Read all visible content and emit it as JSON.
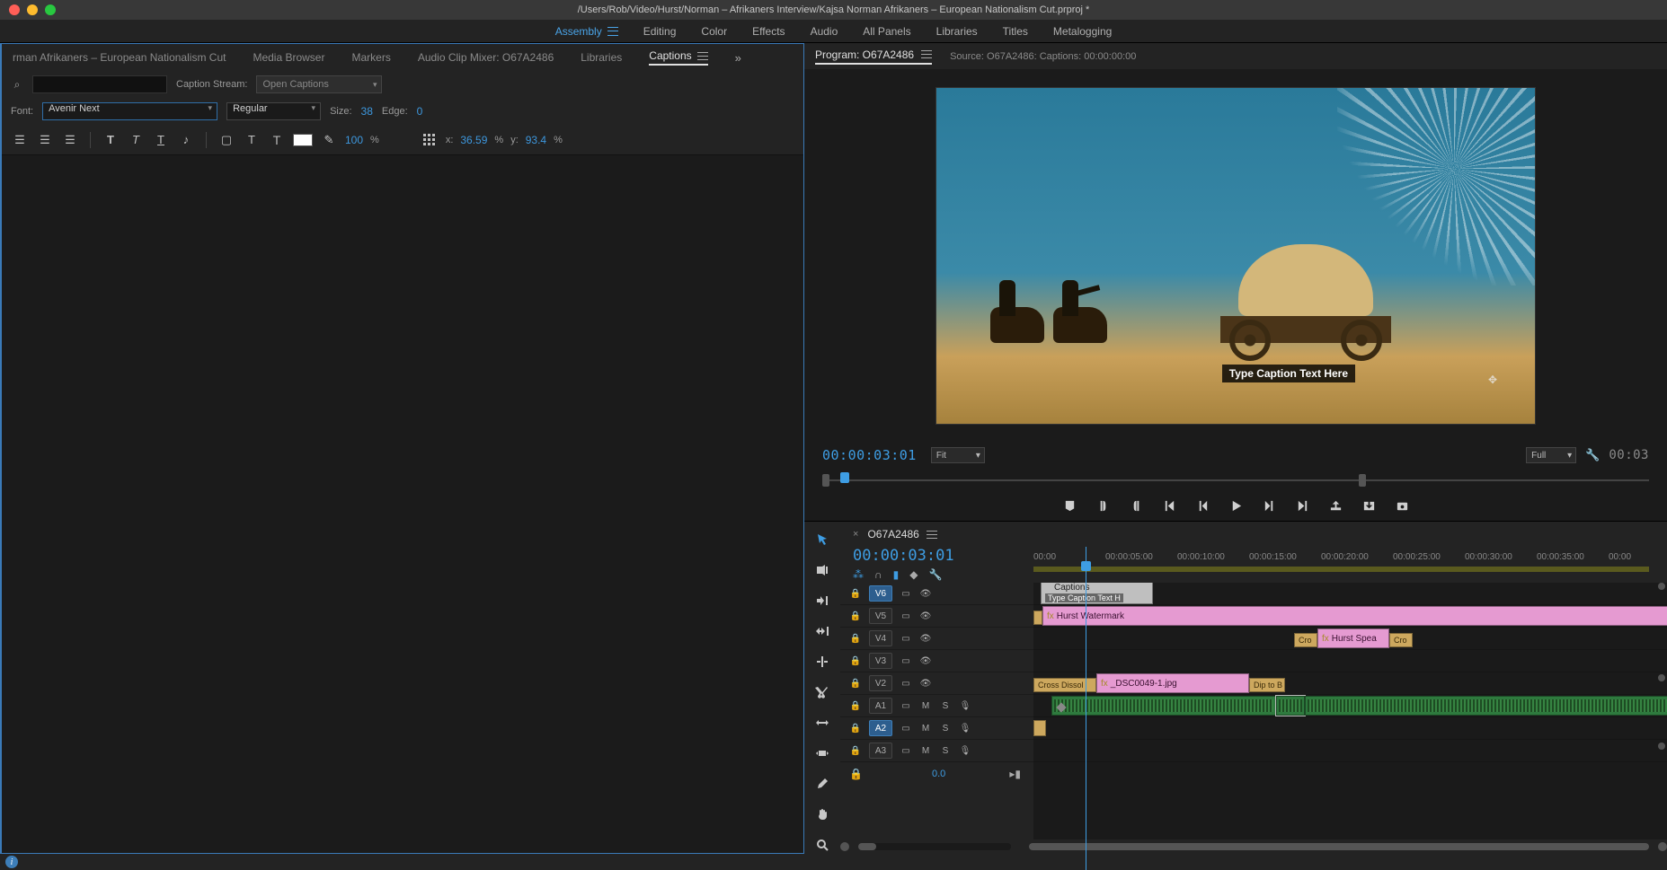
{
  "window": {
    "title": "/Users/Rob/Video/Hurst/Norman – Afrikaners Interview/Kajsa Norman Afrikaners – European Nationalism Cut.prproj *"
  },
  "workspaces": {
    "items": [
      "Assembly",
      "Editing",
      "Color",
      "Effects",
      "Audio",
      "All Panels",
      "Libraries",
      "Titles",
      "Metalogging"
    ],
    "active": "Assembly"
  },
  "left_tabs": {
    "items": [
      "rman Afrikaners – European Nationalism Cut",
      "Media Browser",
      "Markers",
      "Audio Clip Mixer: O67A2486",
      "Libraries",
      "Captions"
    ],
    "active": "Captions"
  },
  "captions": {
    "stream_label": "Caption Stream:",
    "stream_value": "Open Captions",
    "font_label": "Font:",
    "font_value": "Avenir Next",
    "font_style": "Regular",
    "size_label": "Size:",
    "size_value": "38",
    "edge_label": "Edge:",
    "edge_value": "0",
    "opacity": "100",
    "opacity_pct": "%",
    "x_label": "x:",
    "x_value": "36.59",
    "x_pct": "%",
    "y_label": "y:",
    "y_value": "93.4",
    "y_pct": "%"
  },
  "program": {
    "tab_label": "Program: O67A2486",
    "source_meta": "Source: O67A2486: Captions: 00:00:00:00",
    "timecode": "00:00:03:01",
    "fit_label": "Fit",
    "quality": "Full",
    "right_tc": "00:03",
    "caption_placeholder": "Type Caption Text Here"
  },
  "timeline": {
    "sequence": "O67A2486",
    "timecode": "00:00:03:01",
    "ruler": [
      "00:00",
      "00:00:05:00",
      "00:00:10:00",
      "00:00:15:00",
      "00:00:20:00",
      "00:00:25:00",
      "00:00:30:00",
      "00:00:35:00",
      "00:00"
    ],
    "tracks": {
      "v6": "V6",
      "v5": "V5",
      "v4": "V4",
      "v3": "V3",
      "v2": "V2",
      "a1": "A1",
      "a2": "A2",
      "a3": "A3"
    },
    "sync_value": "0.0",
    "clips": {
      "captions_label": "Captions",
      "caption_text": "Type Caption Text H",
      "watermark": "Hurst Watermark",
      "speaker": "Hurst Spea",
      "cro1": "Cro",
      "cro2": "Cro",
      "dsc": "_DSC0049-1.jpg",
      "cross_dissolve": "Cross Dissol",
      "dip": "Dip to B",
      "m_label": "M",
      "s_label": "S"
    }
  }
}
